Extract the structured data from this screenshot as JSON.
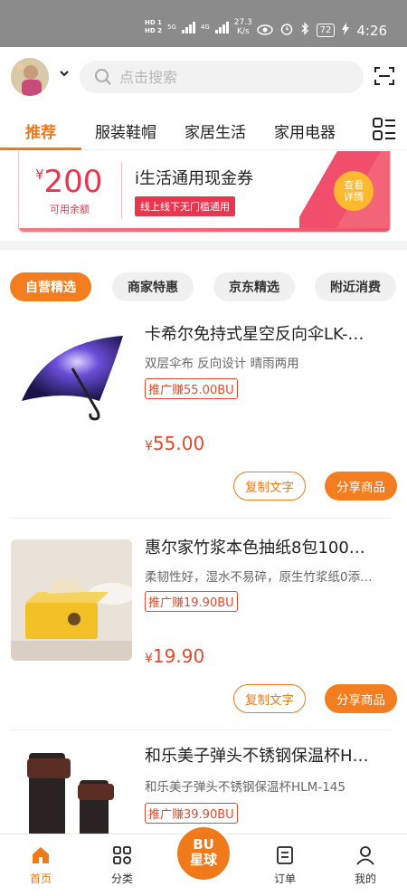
{
  "status_bar": {
    "hd1": "HD 1",
    "hd2": "HD 2",
    "net_5g": "5G",
    "net_4g": "4G",
    "speed_value": "27.3",
    "speed_unit": "K/s",
    "battery": "72",
    "time": "4:26"
  },
  "search": {
    "placeholder": "点击搜索"
  },
  "tabs": [
    {
      "label": "推荐",
      "active": true
    },
    {
      "label": "服装鞋帽"
    },
    {
      "label": "家居生活"
    },
    {
      "label": "家用电器"
    }
  ],
  "coupon": {
    "currency": "¥",
    "amount": "200",
    "amount_label": "可用余额",
    "title": "i生活通用现金券",
    "tag": "线上线下无门槛通用",
    "button": "查看详情"
  },
  "filters": [
    {
      "label": "自营精选",
      "active": true
    },
    {
      "label": "商家特惠"
    },
    {
      "label": "京东精选"
    },
    {
      "label": "附近消费"
    }
  ],
  "products": [
    {
      "title": "卡希尔免持式星空反向伞LK-…",
      "desc": "双层伞布  反向设计  晴雨两用",
      "badge": "推广赚55.00BU",
      "currency": "¥",
      "price": "55.00",
      "copy_label": "复制文字",
      "share_label": "分享商品"
    },
    {
      "title": "惠尔家竹浆本色抽纸8包100…",
      "desc": "柔韧性好，湿水不易碎，原生竹浆纸0添…",
      "badge": "推广赚19.90BU",
      "currency": "¥",
      "price": "19.90",
      "copy_label": "复制文字",
      "share_label": "分享商品"
    },
    {
      "title": "和乐美子弹头不锈钢保温杯H…",
      "desc": "和乐美子弹头不锈钢保温杯HLM-145",
      "badge": "推广赚39.90BU",
      "currency": "¥",
      "price": "",
      "copy_label": "",
      "share_label": ""
    }
  ],
  "bottom_nav": {
    "home": "首页",
    "category": "分类",
    "center_line1": "BU",
    "center_line2": "星球",
    "orders": "订单",
    "mine": "我的"
  },
  "colors": {
    "accent": "#f07a1a",
    "price_red": "#e34a2c",
    "coupon_red": "#e8364e",
    "statusbar": "#8b8b8b"
  }
}
